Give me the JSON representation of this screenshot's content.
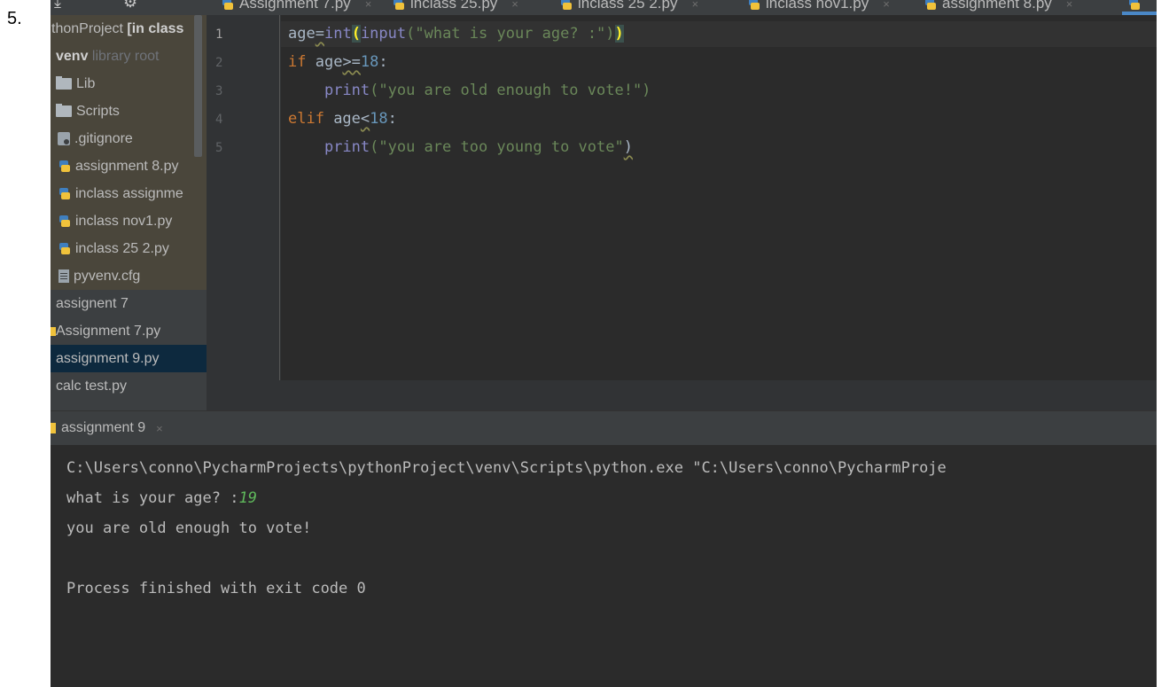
{
  "document": {
    "item_number": "5."
  },
  "tabs": [
    {
      "label": "Assignment 7.py"
    },
    {
      "label": "inclass 25.py"
    },
    {
      "label": "inclass 25 2.py"
    },
    {
      "label": "inclass nov1.py"
    },
    {
      "label": "assignment 8.py"
    }
  ],
  "tab_close_glyph": "×",
  "sidebar": {
    "project_name": "thonProject",
    "project_suffix": "[in class",
    "venv_name": "venv",
    "venv_note": "library root",
    "items": [
      {
        "label": "Lib",
        "icon": "folder-icon"
      },
      {
        "label": "Scripts",
        "icon": "folder-icon"
      },
      {
        "label": ".gitignore",
        "icon": "gitignore-file-icon"
      },
      {
        "label": "assignment 8.py",
        "icon": "python-file-icon"
      },
      {
        "label": "inclass assignme",
        "icon": "python-file-icon"
      },
      {
        "label": "inclass nov1.py",
        "icon": "python-file-icon"
      },
      {
        "label": "inclass 25 2.py",
        "icon": "python-file-icon"
      },
      {
        "label": "pyvenv.cfg",
        "icon": "config-file-icon"
      },
      {
        "label": "assignent 7",
        "icon": ""
      },
      {
        "label": "Assignment 7.py",
        "icon": "python-file-icon"
      },
      {
        "label": "assignment 9.py",
        "icon": "python-file-icon",
        "selected": true
      },
      {
        "label": "calc test.py",
        "icon": ""
      }
    ]
  },
  "editor": {
    "line_numbers": [
      "1",
      "2",
      "3",
      "4",
      "5"
    ],
    "lines": {
      "l1": {
        "var": "age",
        "op": "=",
        "fn1": "int",
        "open_paren": "(",
        "fn2": "input",
        "str": "(\"what is your age? :\")",
        "close": ")"
      },
      "l2": {
        "kw": "if",
        "var": " age",
        "op": ">=",
        "num": "18",
        "colon": ":"
      },
      "l3": {
        "fn": "print",
        "str": "(\"you are old enough to vote!\")"
      },
      "l4": {
        "kw": "elif",
        "var": " age",
        "op": "<",
        "num": "18",
        "colon": ":"
      },
      "l5": {
        "fn": "print",
        "str": "(\"you are too young to vote\"",
        "close": ")"
      }
    }
  },
  "run_panel": {
    "tab_label": "assignment 9",
    "close_glyph": "×",
    "console": {
      "command": "C:\\Users\\conno\\PycharmProjects\\pythonProject\\venv\\Scripts\\python.exe \"C:\\Users\\conno\\PycharmProje",
      "prompt": "what is your age? :",
      "input_value": "19",
      "output": "you are old enough to vote!",
      "exit_message": "Process finished with exit code 0"
    }
  },
  "colors": {
    "editor_bg": "#2b2b2b",
    "panel_bg": "#3c3f41",
    "keyword": "#cc7832",
    "string": "#6a8759",
    "number": "#6897bb",
    "selection": "#0d293e"
  }
}
